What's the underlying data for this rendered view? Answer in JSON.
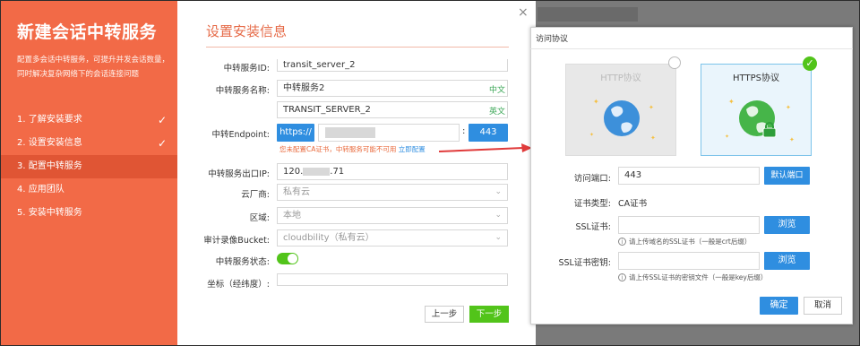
{
  "left": {
    "title": "新建会话中转服务",
    "description": "配置多会话中转服务，可提升并发会话数量，同时解决复杂网络下的会话连接问题",
    "steps": [
      {
        "label": "1. 了解安装要求",
        "done": true
      },
      {
        "label": "2. 设置安装信息",
        "done": true
      },
      {
        "label": "3. 配置中转服务",
        "active": true
      },
      {
        "label": "4. 应用团队"
      },
      {
        "label": "5. 安装中转服务"
      }
    ],
    "check_glyph": "✓"
  },
  "mid": {
    "close_glyph": "×",
    "title": "设置安装信息",
    "service_id": {
      "label": "中转服务ID:",
      "value": "transit_server_2"
    },
    "service_name": {
      "label": "中转服务名称:",
      "value": "中转服务2",
      "suffix": "中文"
    },
    "service_name_en": {
      "value": "TRANSIT_SERVER_2",
      "suffix": "英文"
    },
    "endpoint": {
      "label": "中转Endpoint:",
      "scheme": "https://",
      "colon": ":",
      "port": "443"
    },
    "warning": {
      "text": "您未配置CA证书，中转服务可能不可用",
      "link": "立即配置"
    },
    "exit_ip": {
      "label": "中转服务出口IP:",
      "prefix": "120.",
      "suffix": ".71"
    },
    "cloud": {
      "label": "云厂商:",
      "value": "私有云"
    },
    "region": {
      "label": "区域:",
      "value": "本地"
    },
    "bucket": {
      "label": "审计录像Bucket:",
      "value": "cloudbility（私有云）"
    },
    "status": {
      "label": "中转服务状态:",
      "on": true
    },
    "coords": {
      "label": "坐标（经纬度）:"
    },
    "prev": "上一步",
    "next": "下一步"
  },
  "dialog": {
    "title": "访问协议",
    "http": {
      "label": "HTTP协议"
    },
    "https": {
      "label": "HTTPS协议",
      "selected": true
    },
    "port": {
      "label": "访问端口:",
      "value": "443",
      "button": "默认端口"
    },
    "cert_type": {
      "label": "证书类型:",
      "value": "CA证书"
    },
    "ssl_cert": {
      "label": "SSL证书:",
      "button": "浏览",
      "hint": "请上传域名的SSL证书（一般是crt后缀）"
    },
    "ssl_key": {
      "label": "SSL证书密钥:",
      "button": "浏览",
      "hint": "请上传SSL证书的密钥文件（一般是key后缀）"
    },
    "confirm": "确定",
    "cancel": "取消"
  },
  "colors": {
    "accent": "#f26a47",
    "primary": "#2f8ee0",
    "success": "#52c41a",
    "warn": "#e96a3c",
    "arrow": "#e03a3a"
  },
  "icons": [
    "close-icon",
    "check-icon",
    "chevron-down-icon",
    "globe-icon",
    "lock-icon",
    "info-icon",
    "arrow-icon"
  ]
}
